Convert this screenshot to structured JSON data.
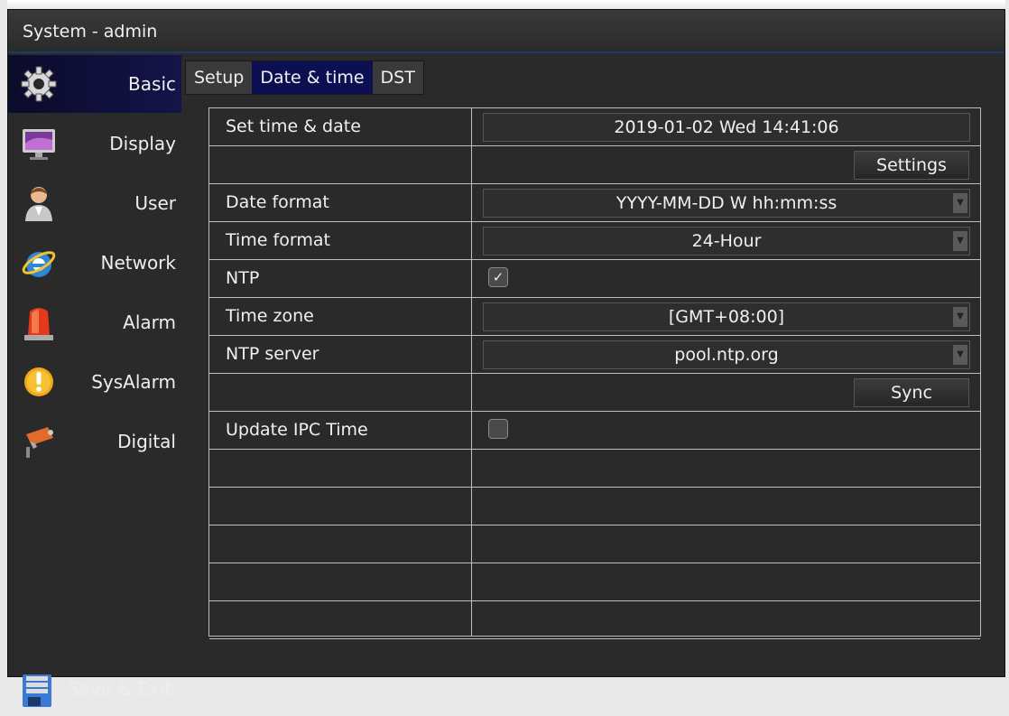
{
  "window": {
    "title": "System - admin"
  },
  "sidebar": {
    "items": [
      {
        "label": "Basic",
        "icon": "gear-icon",
        "active": true
      },
      {
        "label": "Display",
        "icon": "monitor-icon",
        "active": false
      },
      {
        "label": "User",
        "icon": "user-icon",
        "active": false
      },
      {
        "label": "Network",
        "icon": "internet-explorer-icon",
        "active": false
      },
      {
        "label": "Alarm",
        "icon": "siren-icon",
        "active": false
      },
      {
        "label": "SysAlarm",
        "icon": "warning-icon",
        "active": false
      },
      {
        "label": "Digital",
        "icon": "ip-camera-icon",
        "active": false
      }
    ],
    "save_exit": {
      "label": "Save & Exit",
      "icon": "floppy-disk-icon"
    }
  },
  "tabs": [
    {
      "label": "Setup",
      "active": false
    },
    {
      "label": "Date & time",
      "active": true
    },
    {
      "label": "DST",
      "active": false
    }
  ],
  "form": {
    "set_time_date": {
      "label": "Set time & date",
      "value": "2019-01-02 Wed 14:41:06"
    },
    "settings_button": "Settings",
    "date_format": {
      "label": "Date format",
      "value": "YYYY-MM-DD W hh:mm:ss"
    },
    "time_format": {
      "label": "Time format",
      "value": "24-Hour"
    },
    "ntp": {
      "label": "NTP",
      "checked": true
    },
    "time_zone": {
      "label": "Time zone",
      "value": "[GMT+08:00]"
    },
    "ntp_server": {
      "label": "NTP server",
      "value": "pool.ntp.org"
    },
    "sync_button": "Sync",
    "update_ipc_time": {
      "label": "Update IPC Time",
      "checked": false
    }
  },
  "colors": {
    "background": "#2a2a2a",
    "active_tab": "#0c1052",
    "title_accent": "#1a3a6a",
    "grid_line": "#bdbdbd"
  }
}
